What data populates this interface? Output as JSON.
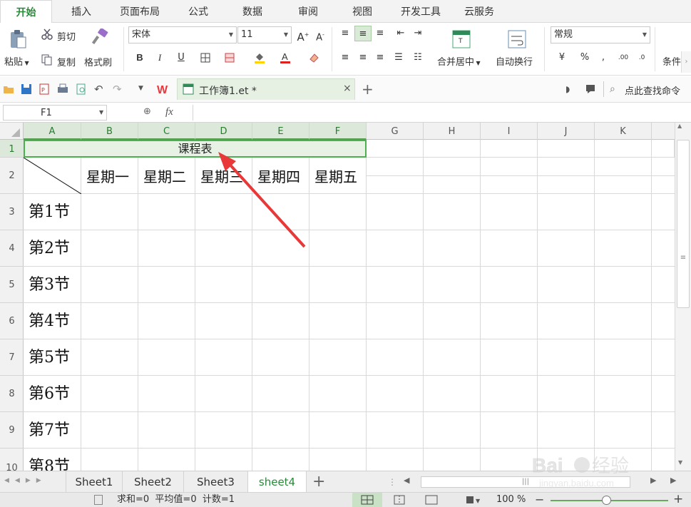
{
  "menu_tabs": [
    "开始",
    "插入",
    "页面布局",
    "公式",
    "数据",
    "审阅",
    "视图",
    "开发工具",
    "云服务"
  ],
  "ribbon": {
    "paste": "粘贴",
    "cut": "剪切",
    "copy": "复制",
    "format_painter": "格式刷",
    "font_name": "宋体",
    "font_size": "11",
    "merge_center": "合并居中",
    "wrap_text": "自动换行",
    "number_format": "常规",
    "conditional": "条件"
  },
  "quick": {
    "doc_title": "工作簿1.et *",
    "search_cmd": "点此查找命令"
  },
  "formula_bar": {
    "name_box": "F1",
    "fx": "fx",
    "content": ""
  },
  "columns": [
    "A",
    "B",
    "C",
    "D",
    "E",
    "F",
    "G",
    "H",
    "I",
    "J",
    "K"
  ],
  "rows": [
    "1",
    "2",
    "3",
    "4",
    "5",
    "6",
    "7",
    "8",
    "9",
    "10"
  ],
  "sheet": {
    "title": "课程表",
    "days": [
      "星期一",
      "星期二",
      "星期三",
      "星期四",
      "星期五"
    ],
    "periods": [
      "第1节",
      "第2节",
      "第3节",
      "第4节",
      "第5节",
      "第6节",
      "第7节",
      "第8节"
    ]
  },
  "sheet_tabs": [
    "Sheet1",
    "Sheet2",
    "Sheet3",
    "sheet4"
  ],
  "active_sheet": "sheet4",
  "status": {
    "summary": "求和=0  平均值=0  计数=1",
    "zoom": "100 %"
  },
  "watermark": "Baidu经验 jingyan.baidu.com",
  "colors": {
    "accent_green": "#2a8a3a",
    "selection_border": "#4caf50",
    "arrow_red": "#e83838"
  }
}
